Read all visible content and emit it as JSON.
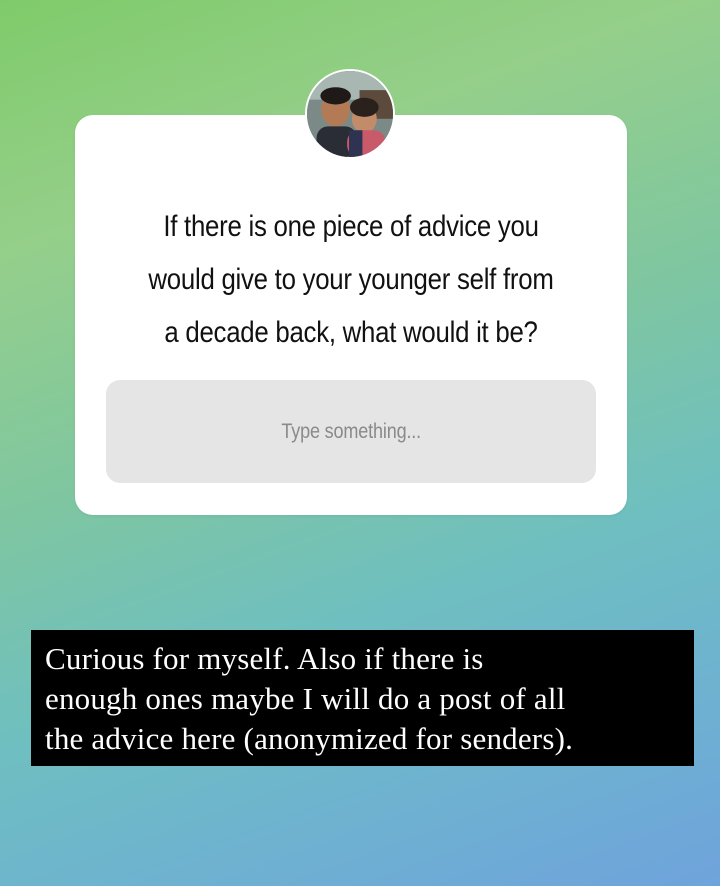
{
  "question_sticker": {
    "question": "If there is one piece of advice you\nwould give to your younger self from\na decade back, what would it be?",
    "input_placeholder": "Type something..."
  },
  "caption": {
    "text": "Curious for myself. Also if there is\nenough ones maybe I will do a post of all\nthe advice here (anonymized for senders)."
  },
  "colors": {
    "background_top": "#7fcb6a",
    "background_bottom": "#6fa3dc",
    "card": "#ffffff",
    "input_fill": "#e5e5e5",
    "caption_box": "#000000"
  }
}
